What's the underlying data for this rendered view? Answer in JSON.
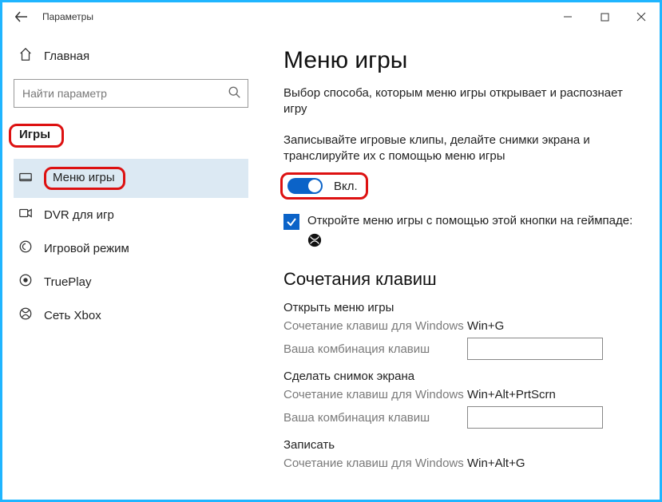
{
  "window": {
    "title": "Параметры"
  },
  "sidebar": {
    "home_label": "Главная",
    "search_placeholder": "Найти параметр",
    "category": "Игры",
    "items": [
      {
        "label": "Меню игры"
      },
      {
        "label": "DVR для игр"
      },
      {
        "label": "Игровой режим"
      },
      {
        "label": "TruePlay"
      },
      {
        "label": "Сеть Xbox"
      }
    ]
  },
  "content": {
    "heading": "Меню игры",
    "desc1": "Выбор способа, которым меню игры открывает и распознает игру",
    "desc2": "Записывайте игровые клипы, делайте снимки экрана и транслируйте их с помощью меню игры",
    "toggle_label": "Вкл.",
    "toggle_on": true,
    "checkbox_label": "Откройте меню игры с помощью этой кнопки на геймпаде:",
    "shortcuts_heading": "Сочетания клавиш",
    "shortcut_windows_label": "Сочетание клавиш для Windows",
    "shortcut_user_label": "Ваша комбинация клавиш",
    "groups": [
      {
        "title": "Открыть меню игры",
        "win": "Win+G"
      },
      {
        "title": "Сделать снимок экрана",
        "win": "Win+Alt+PrtScrn"
      },
      {
        "title": "Записать",
        "win": "Win+Alt+G"
      }
    ]
  }
}
